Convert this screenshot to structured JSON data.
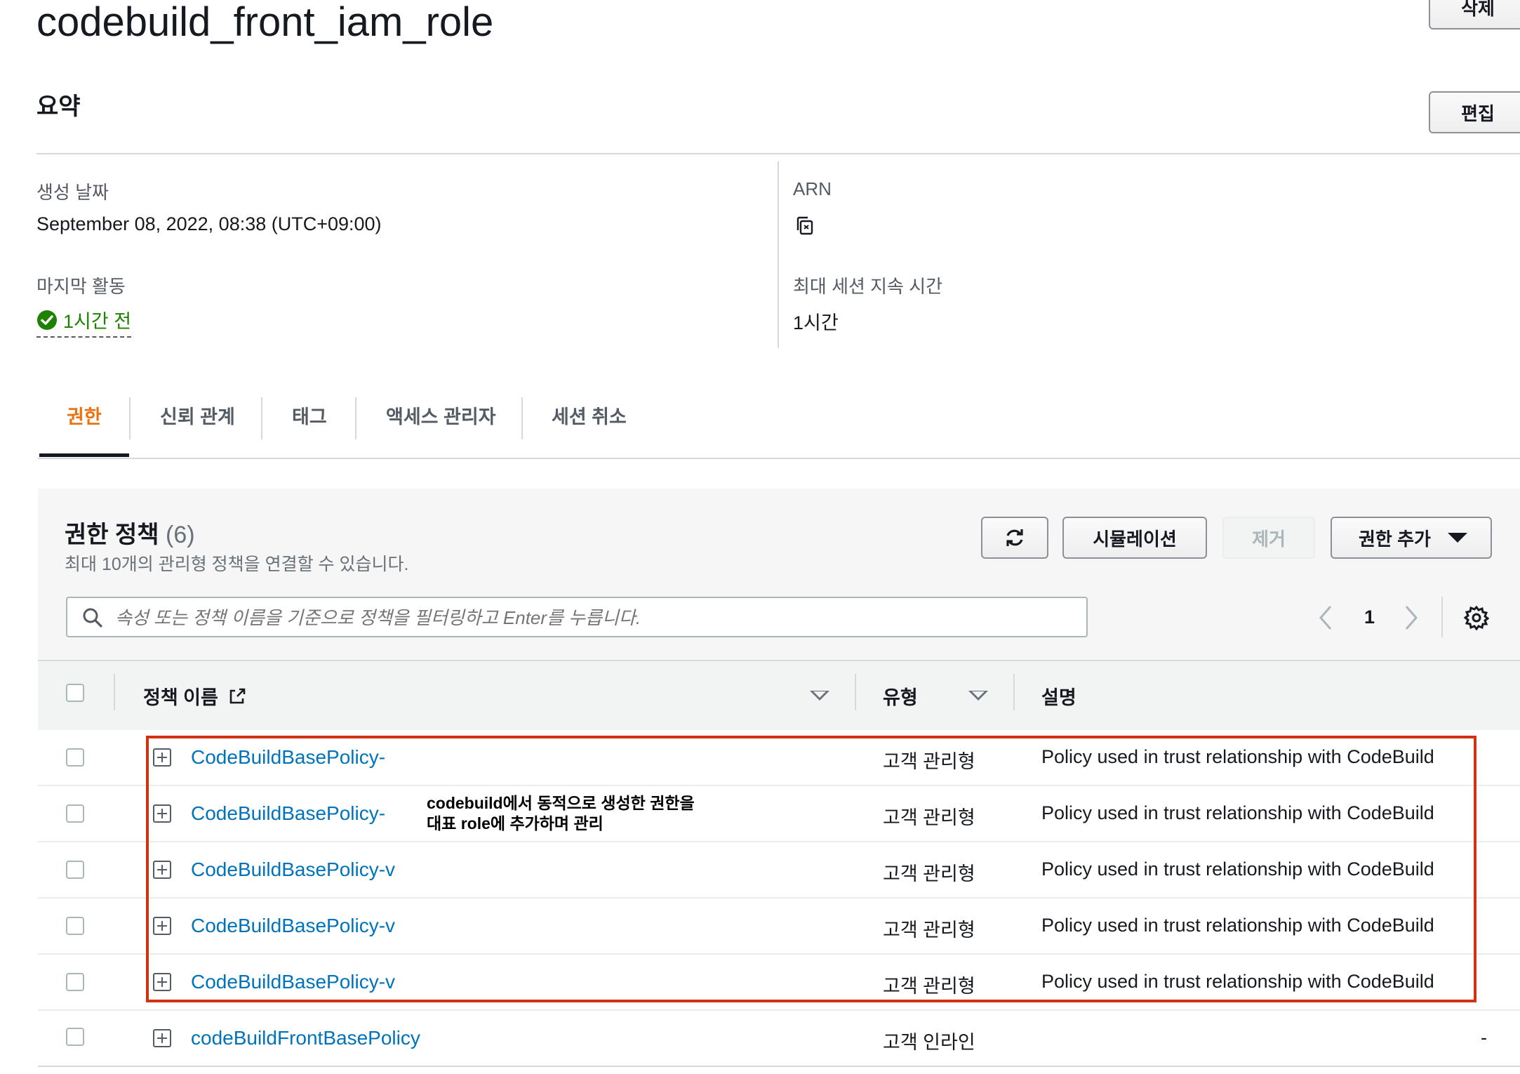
{
  "page": {
    "title": "codebuild_front_iam_role"
  },
  "header": {
    "delete_label": "삭제",
    "edit_label": "편집"
  },
  "summary": {
    "heading": "요약",
    "created_label": "생성 날짜",
    "created_value": "September 08, 2022, 08:38 (UTC+09:00)",
    "last_activity_label": "마지막 활동",
    "last_activity_value": "1시간 전",
    "arn_label": "ARN",
    "max_session_label": "최대 세션 지속 시간",
    "max_session_value": "1시간"
  },
  "tabs": [
    {
      "label": "권한",
      "active": true
    },
    {
      "label": "신뢰 관계"
    },
    {
      "label": "태그"
    },
    {
      "label": "액세스 관리자"
    },
    {
      "label": "세션 취소"
    }
  ],
  "policies": {
    "heading": "권한 정책",
    "count": "(6)",
    "subtitle": "최대 10개의 관리형 정책을 연결할 수 있습니다.",
    "simulate_label": "시뮬레이션",
    "remove_label": "제거",
    "add_label": "권한 추가",
    "search_placeholder": "속성 또는 정책 이름을 기준으로 정책을 필터링하고 Enter를 누릅니다.",
    "page_number": "1",
    "columns": {
      "name": "정책 이름",
      "type": "유형",
      "description": "설명"
    },
    "rows": [
      {
        "name": "CodeBuildBasePolicy-",
        "type": "고객 관리형",
        "description": "Policy used in trust relationship with CodeBuild"
      },
      {
        "name": "CodeBuildBasePolicy-",
        "type": "고객 관리형",
        "description": "Policy used in trust relationship with CodeBuild"
      },
      {
        "name": "CodeBuildBasePolicy-v",
        "type": "고객 관리형",
        "description": "Policy used in trust relationship with CodeBuild"
      },
      {
        "name": "CodeBuildBasePolicy-v",
        "type": "고객 관리형",
        "description": "Policy used in trust relationship with CodeBuild"
      },
      {
        "name": "CodeBuildBasePolicy-v",
        "type": "고객 관리형",
        "description": "Policy used in trust relationship with CodeBuild"
      },
      {
        "name": "codeBuildFrontBasePolicy",
        "type": "고객 인라인",
        "description": "-"
      }
    ],
    "annotation": {
      "line1": "codebuild에서 동적으로 생성한 권한을",
      "line2": "대표 role에 추가하며 관리"
    }
  },
  "colors": {
    "accent_orange": "#ec7211",
    "link_blue": "#0073bb",
    "success_green": "#1d8102",
    "highlight_red": "#d13212"
  },
  "icons": [
    "refresh-icon",
    "caret-down-icon",
    "search-icon",
    "chevron-left-icon",
    "chevron-right-icon",
    "gear-icon",
    "external-link-icon",
    "copy-icon",
    "check-circle-icon",
    "expand-plus-icon",
    "sort-icon"
  ]
}
